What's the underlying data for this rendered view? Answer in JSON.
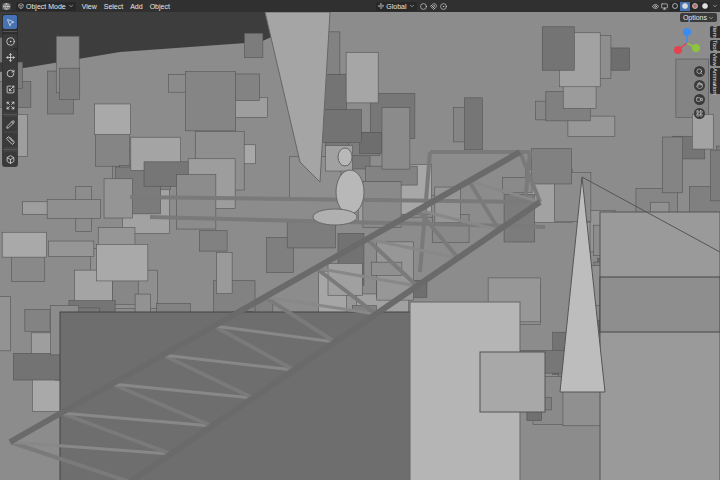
{
  "header": {
    "mode": "Object Mode",
    "menus": [
      "View",
      "Select",
      "Add",
      "Object"
    ],
    "orientation": "Global"
  },
  "shading": [
    {
      "kind": "wireframe",
      "selected": false
    },
    {
      "kind": "solid",
      "selected": true
    },
    {
      "kind": "material",
      "selected": false
    },
    {
      "kind": "rendered",
      "selected": false
    }
  ],
  "toolbar": [
    {
      "kind": "select",
      "selected": true
    },
    {
      "kind": "cursor",
      "selected": false
    },
    {
      "kind": "move",
      "selected": false
    },
    {
      "kind": "rotate",
      "selected": false
    },
    {
      "kind": "scale",
      "selected": false
    },
    {
      "kind": "transform",
      "selected": false
    },
    {
      "kind": "annotate",
      "selected": false
    },
    {
      "kind": "measure",
      "selected": false
    },
    {
      "kind": "add-cube",
      "selected": false
    }
  ],
  "options": "Options",
  "gizmo": [
    {
      "axis": "x",
      "color": "#e2434f"
    },
    {
      "axis": "y",
      "color": "#8cc43c"
    },
    {
      "axis": "z",
      "color": "#3c8cf0"
    }
  ],
  "sidebar_tabs": [
    {
      "label": "Item",
      "selected": false
    },
    {
      "label": "Tool",
      "selected": false
    },
    {
      "label": "View",
      "selected": false
    },
    {
      "label": "Animation",
      "selected": false
    }
  ]
}
